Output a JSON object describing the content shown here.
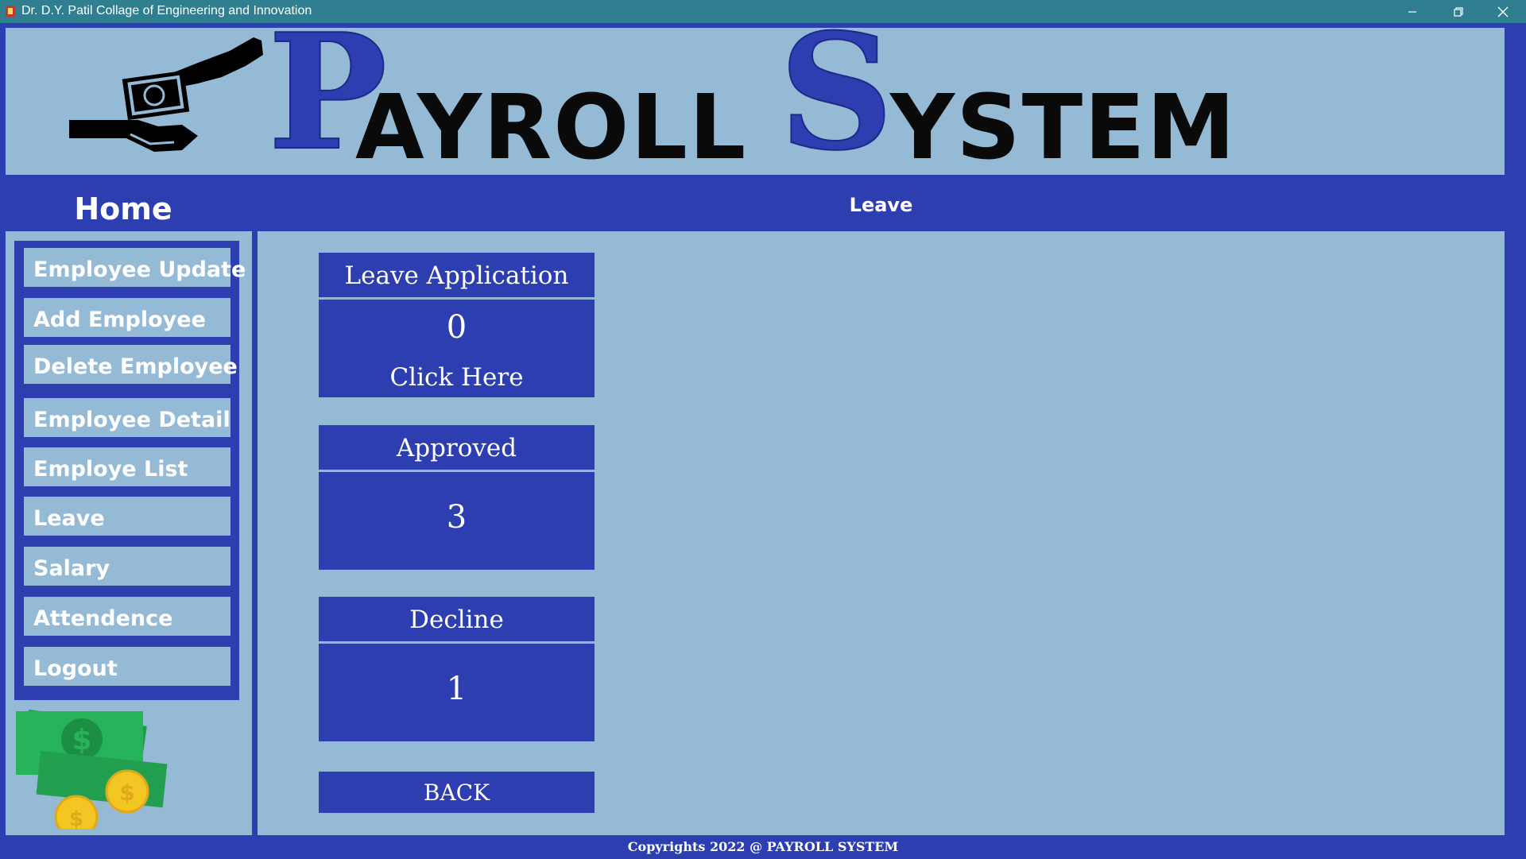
{
  "window": {
    "title": "Dr. D.Y. Patil Collage of Engineering and Innovation",
    "minimize_icon": "minimize-icon",
    "restore_icon": "restore-icon",
    "close_icon": "close-icon"
  },
  "header": {
    "brand_first_initial": "P",
    "brand_first_rest": "AYROLL",
    "brand_second_initial": "S",
    "brand_second_rest": "YSTEM",
    "logo_icon": "hands-money-icon"
  },
  "sidebar": {
    "title": "Home",
    "items": [
      {
        "label": "Employee Update"
      },
      {
        "label": "Add Employee"
      },
      {
        "label": "Delete Employee"
      },
      {
        "label": "Employee Detail"
      },
      {
        "label": "Employe List"
      },
      {
        "label": "Leave"
      },
      {
        "label": "Salary"
      },
      {
        "label": "Attendence"
      },
      {
        "label": "Logout"
      }
    ],
    "art_icon": "cash-coins-icon"
  },
  "main": {
    "section_title": "Leave",
    "cards": [
      {
        "label": "Leave Application",
        "value": "0",
        "link": "Click Here"
      },
      {
        "label": "Approved",
        "value": "3"
      },
      {
        "label": "Decline",
        "value": "1"
      }
    ],
    "back_label": "BACK"
  },
  "footer": {
    "copyright": "Copyrights 2022 @ PAYROLL SYSTEM"
  },
  "colors": {
    "primary_blue": "#2c3eb0",
    "panel_light": "#94bad5",
    "titlebar": "#2f7f91"
  }
}
